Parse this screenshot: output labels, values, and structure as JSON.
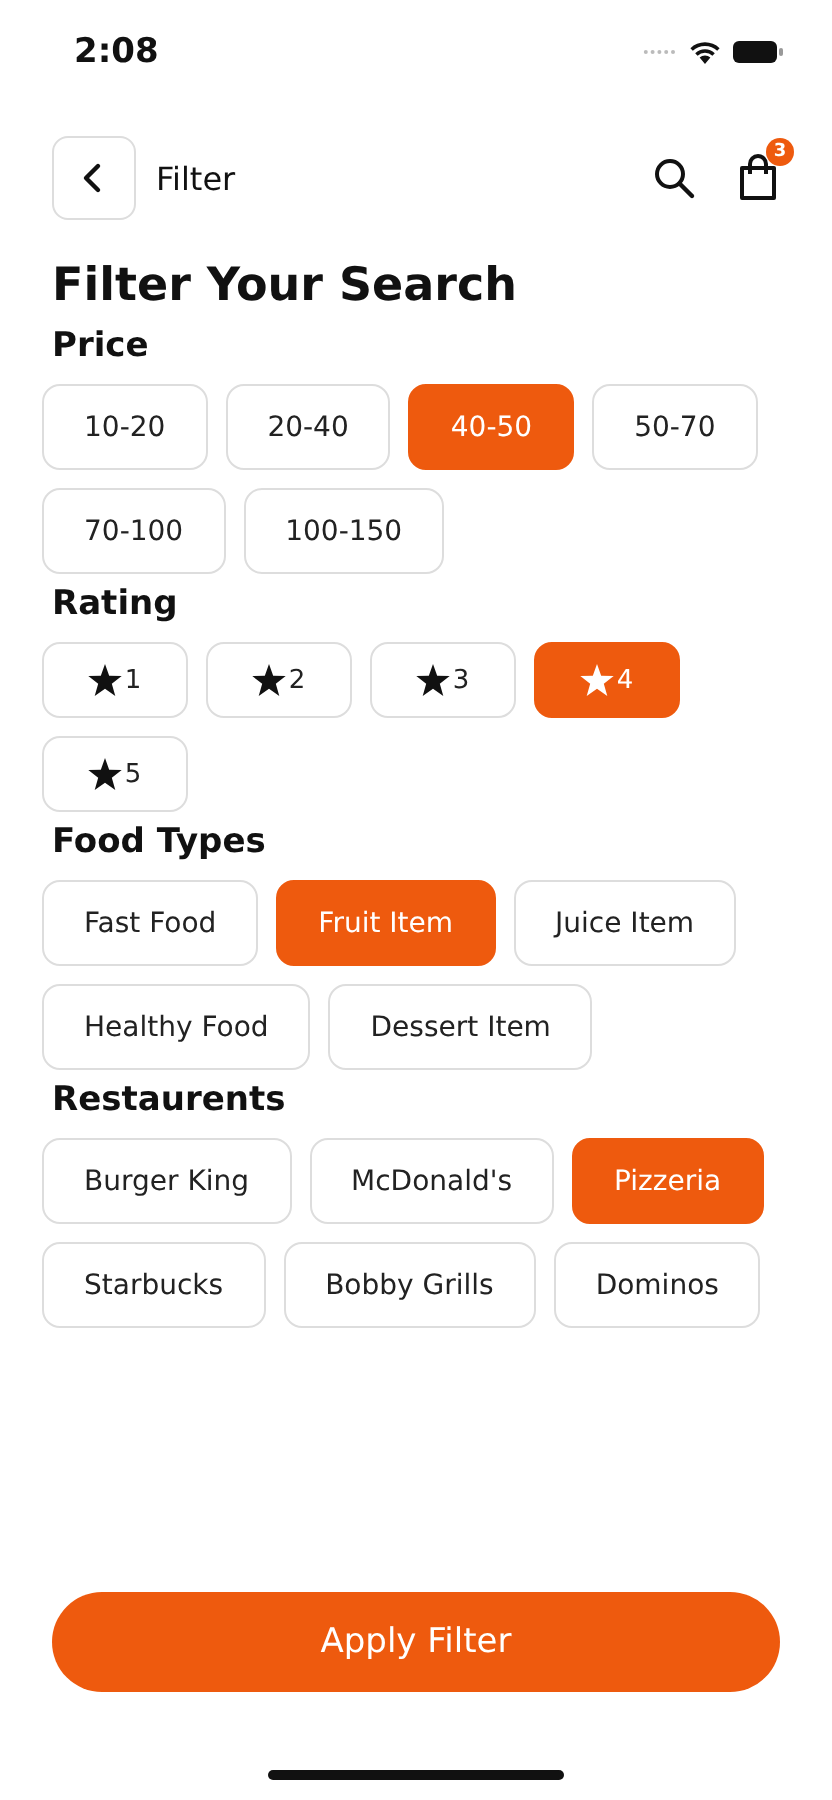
{
  "status_bar": {
    "time": "2:08"
  },
  "header": {
    "title": "Filter",
    "cart_count": "3"
  },
  "heading": "Filter Your Search",
  "sections": [
    {
      "title": "Price",
      "kind": "text",
      "options": [
        {
          "label": "10-20",
          "selected": false
        },
        {
          "label": "20-40",
          "selected": false
        },
        {
          "label": "40-50",
          "selected": true
        },
        {
          "label": "50-70",
          "selected": false
        },
        {
          "label": "70-100",
          "selected": false
        },
        {
          "label": "100-150",
          "selected": false
        }
      ]
    },
    {
      "title": "Rating",
      "kind": "rating",
      "options": [
        {
          "label": "1",
          "selected": false
        },
        {
          "label": "2",
          "selected": false
        },
        {
          "label": "3",
          "selected": false
        },
        {
          "label": "4",
          "selected": true
        },
        {
          "label": "5",
          "selected": false
        }
      ]
    },
    {
      "title": "Food Types",
      "kind": "text",
      "options": [
        {
          "label": "Fast Food",
          "selected": false
        },
        {
          "label": "Fruit Item",
          "selected": true
        },
        {
          "label": "Juice Item",
          "selected": false
        },
        {
          "label": "Healthy Food",
          "selected": false
        },
        {
          "label": "Dessert Item",
          "selected": false
        }
      ]
    },
    {
      "title": "Restaurents",
      "kind": "text",
      "options": [
        {
          "label": "Burger King",
          "selected": false
        },
        {
          "label": "McDonald's",
          "selected": false
        },
        {
          "label": "Pizzeria",
          "selected": true
        },
        {
          "label": "Starbucks",
          "selected": false
        },
        {
          "label": "Bobby Grills",
          "selected": false
        },
        {
          "label": "Dominos",
          "selected": false
        }
      ]
    }
  ],
  "apply_button": "Apply Filter"
}
